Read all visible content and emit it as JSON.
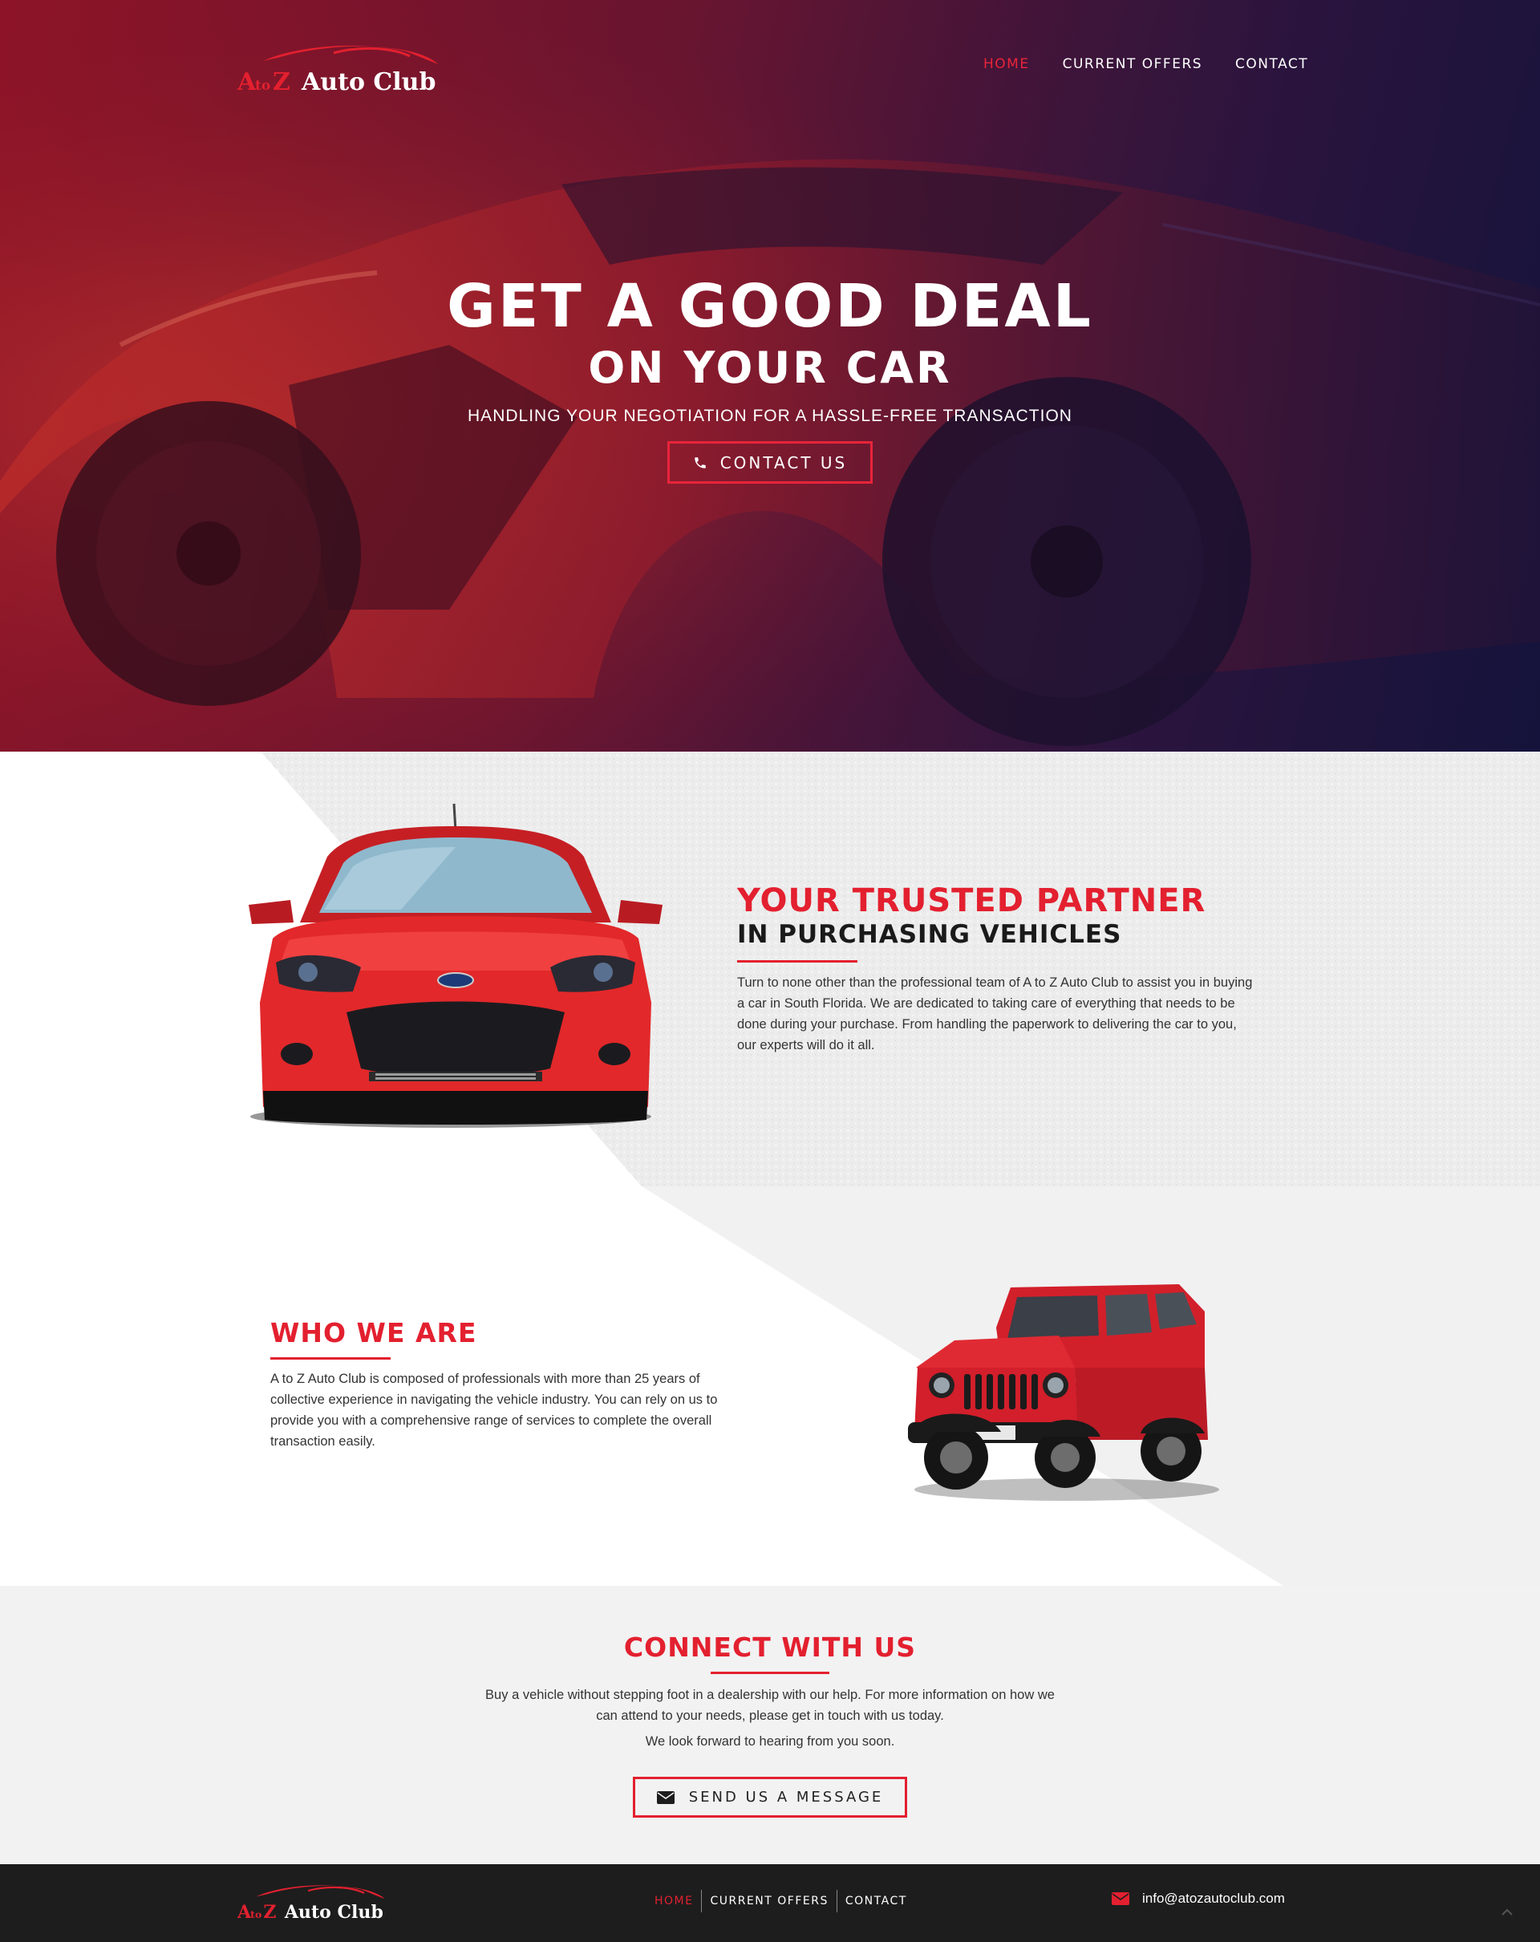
{
  "brand": {
    "logo_text_a": "A",
    "logo_text_to": "to",
    "logo_text_z": "Z",
    "logo_text_main": "Auto Club",
    "accent_color": "#e3202f"
  },
  "nav": {
    "items": [
      {
        "label": "HOME",
        "active": true
      },
      {
        "label": "CURRENT OFFERS",
        "active": false
      },
      {
        "label": "CONTACT",
        "active": false
      }
    ]
  },
  "hero": {
    "title_line1": "GET A GOOD DEAL",
    "title_line2": "ON YOUR CAR",
    "subtitle": "HANDLING YOUR NEGOTIATION FOR A HASSLE-FREE TRANSACTION",
    "cta_label": "CONTACT US",
    "cta_icon": "phone-icon"
  },
  "partner": {
    "heading_line1": "YOUR TRUSTED PARTNER",
    "heading_line2": "IN PURCHASING VEHICLES",
    "paragraph_lines": [
      "Turn to none other than the professional team of A to Z Auto Club to assist you in buying",
      "a car in South Florida. We are dedicated to taking care of everything that needs to be",
      "done during your purchase. From handling the paperwork to delivering the car to you,",
      "our experts will do it all."
    ],
    "car_image": "red-hatchback-front"
  },
  "who": {
    "heading": "WHO WE ARE",
    "paragraph_lines": [
      "A to Z Auto Club is composed of professionals with more than 25 years of",
      "collective experience in navigating the vehicle industry. You can rely on us to",
      "provide you with a comprehensive range of services to complete the overall",
      "transaction easily."
    ],
    "car_image": "red-jeep"
  },
  "connect": {
    "heading": "CONNECT WITH US",
    "paragraph_lines": [
      "Buy a vehicle without stepping foot in a dealership with our help. For more information on how we",
      "can attend to your needs, please get in touch with us today."
    ],
    "paragraph2": "We look forward to hearing from you soon.",
    "button_label": "SEND US A MESSAGE",
    "button_icon": "envelope-icon"
  },
  "footer": {
    "nav": [
      {
        "label": "HOME",
        "active": true
      },
      {
        "label": "CURRENT OFFERS",
        "active": false
      },
      {
        "label": "CONTACT",
        "active": false
      }
    ],
    "email": "info@atozautoclub.com",
    "email_icon": "envelope-icon",
    "background": "#1d1d1d"
  }
}
